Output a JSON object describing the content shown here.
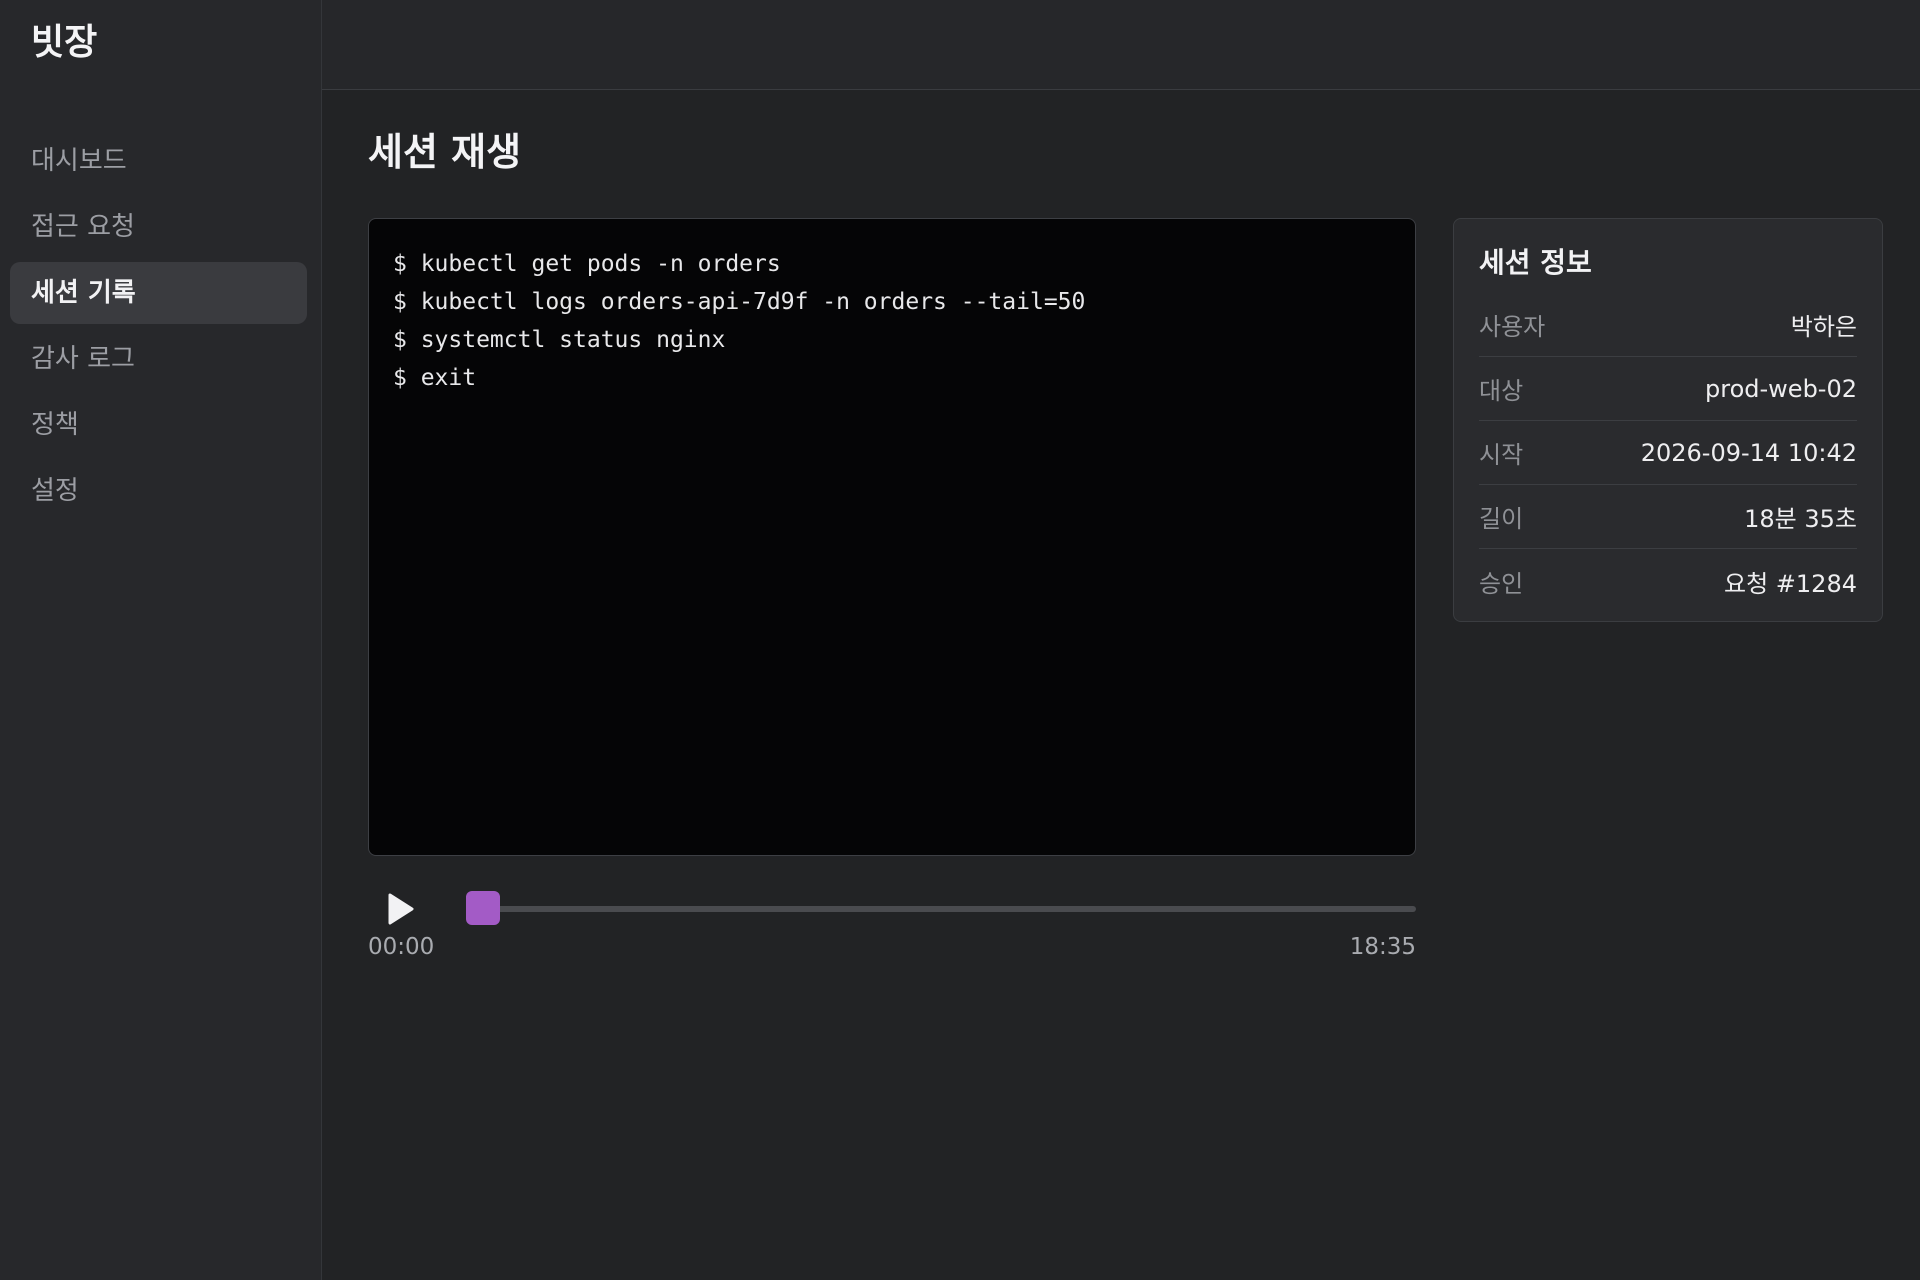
{
  "app": {
    "brand": "빗장"
  },
  "sidebar": {
    "items": [
      {
        "label": "대시보드",
        "active": false
      },
      {
        "label": "접근 요청",
        "active": false
      },
      {
        "label": "세션 기록",
        "active": true
      },
      {
        "label": "감사 로그",
        "active": false
      },
      {
        "label": "정책",
        "active": false
      },
      {
        "label": "설정",
        "active": false
      }
    ]
  },
  "main": {
    "title": "세션 재생"
  },
  "terminal": {
    "lines": [
      "$ kubectl get pods -n orders",
      "$ kubectl logs orders-api-7d9f -n orders --tail=50",
      "$ systemctl status nginx",
      "$ exit"
    ]
  },
  "player": {
    "current_time": "00:00",
    "total_time": "18:35",
    "progress": 0.0,
    "play_icon": "play-icon",
    "accent": "#a35bc6"
  },
  "info": {
    "title": "세션 정보",
    "rows": [
      {
        "label": "사용자",
        "value": "박하은"
      },
      {
        "label": "대상",
        "value": "prod-web-02"
      },
      {
        "label": "시작",
        "value": "2026-09-14 10:42"
      },
      {
        "label": "길이",
        "value": "18분 35초"
      },
      {
        "label": "승인",
        "value": "요청 #1284"
      }
    ]
  }
}
